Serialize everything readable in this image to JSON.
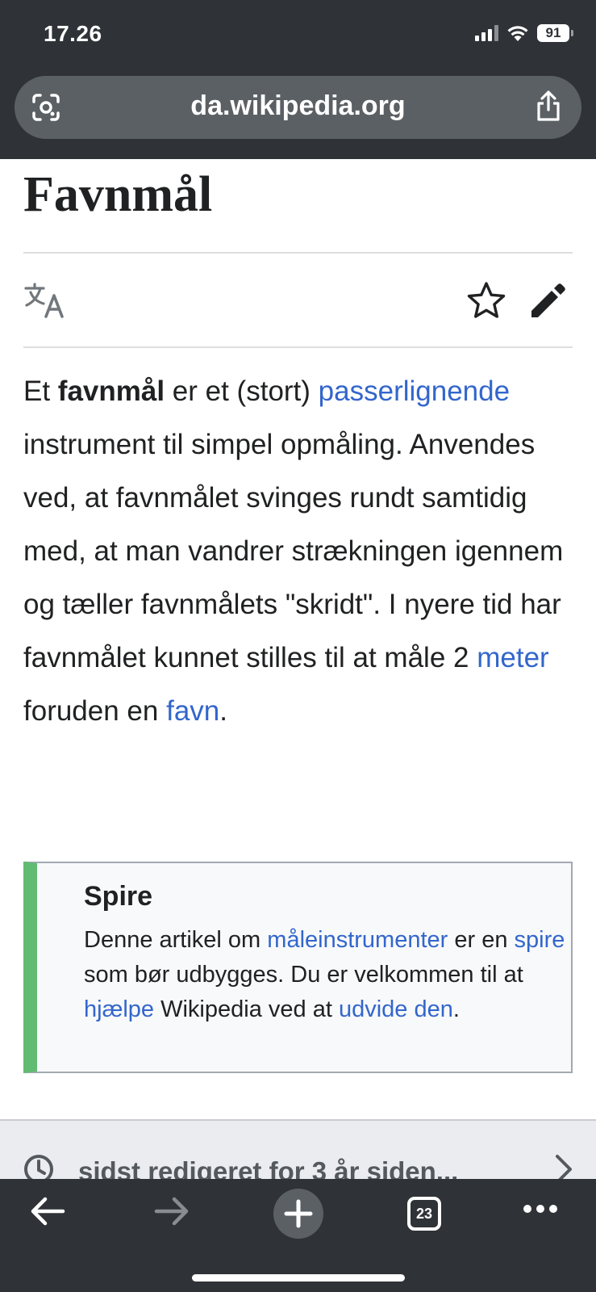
{
  "status_bar": {
    "time": "17.26",
    "battery": "91"
  },
  "url_bar": {
    "url": "da.wikipedia.org"
  },
  "article": {
    "title": "Favnmål",
    "paragraph": [
      {
        "text": "Et ",
        "style": "plain"
      },
      {
        "text": "favnmål",
        "style": "bold"
      },
      {
        "text": " er et (stort) ",
        "style": "plain"
      },
      {
        "text": "passerlignende",
        "style": "link"
      },
      {
        "text": " instrument til simpel opmåling. Anvendes ved, at favnmålet svinges rundt samtidig med, at man vandrer strækningen igennem og tæller favnmålets \"skridt\". I nyere tid har favnmålet kunnet stilles til at måle 2 ",
        "style": "plain"
      },
      {
        "text": "meter",
        "style": "link"
      },
      {
        "text": " foruden en ",
        "style": "plain"
      },
      {
        "text": "favn",
        "style": "link"
      },
      {
        "text": ".",
        "style": "plain"
      }
    ]
  },
  "stub_box": {
    "title": "Spire",
    "text": [
      {
        "text": "Denne artikel om ",
        "style": "plain"
      },
      {
        "text": "måleinstrumenter",
        "style": "link"
      },
      {
        "text": " er en ",
        "style": "plain"
      },
      {
        "text": "spire",
        "style": "link"
      },
      {
        "text": " som bør udbygges. Du er velkommen til at ",
        "style": "plain"
      },
      {
        "text": "hjælpe",
        "style": "link"
      },
      {
        "text": " Wikipedia ved at ",
        "style": "plain"
      },
      {
        "text": "udvide den",
        "style": "link"
      },
      {
        "text": ".",
        "style": "plain"
      }
    ]
  },
  "last_edited": {
    "label": "sidst redigeret for 3 år siden..."
  },
  "toolbar": {
    "tab_count": "23"
  },
  "colors": {
    "chrome": "#2f3337",
    "url_bar": "#5b6064",
    "link": "#3366cc",
    "stub_accent": "#62bb73"
  },
  "icons": [
    "lens-icon",
    "share-icon",
    "translate-icon",
    "star-icon",
    "edit-icon",
    "history-icon",
    "chevron-right-icon",
    "back-arrow-icon",
    "forward-arrow-icon",
    "plus-icon",
    "tabs-icon",
    "more-icon"
  ]
}
